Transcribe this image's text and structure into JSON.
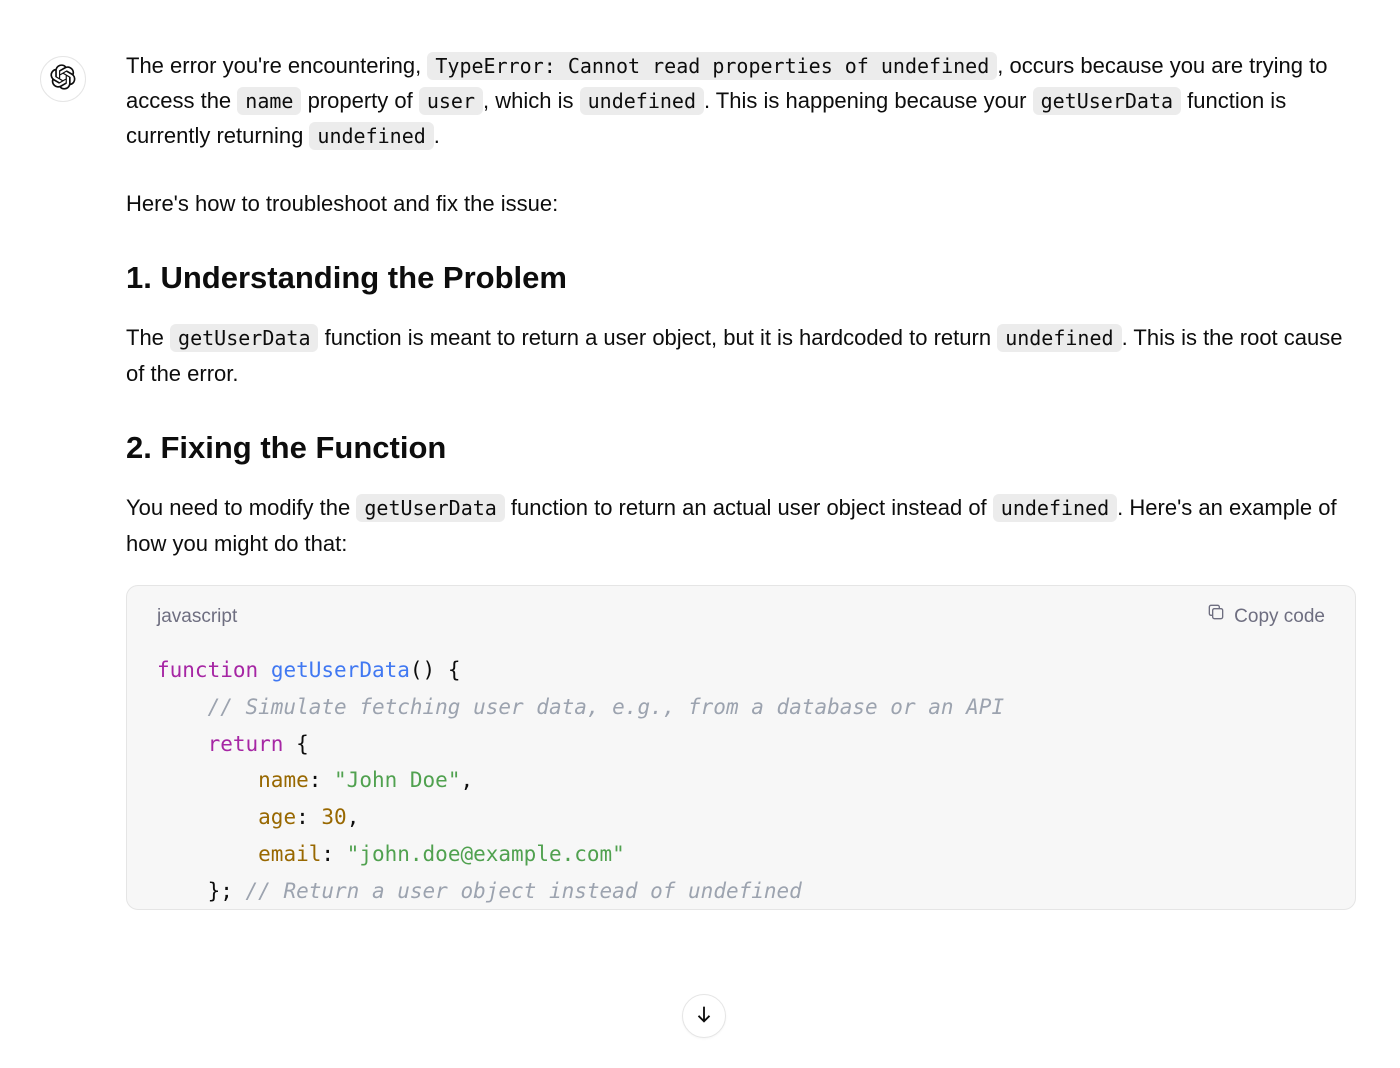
{
  "msg": {
    "intro": {
      "t0": "The error you're encountering, ",
      "c0": "TypeError: Cannot read properties of undefined",
      "t1": ", occurs because you are trying to access the ",
      "c1": "name",
      "t2": " property of ",
      "c2": "user",
      "t3": ", which is ",
      "c3": "undefined",
      "t4": ". This is happening because your ",
      "c4": "getUserData",
      "t5": " function is currently returning ",
      "c5": "undefined",
      "t6": "."
    },
    "lead": "Here's how to troubleshoot and fix the issue:",
    "h1": "1. Understanding the Problem",
    "p1": {
      "t0": "The ",
      "c0": "getUserData",
      "t1": " function is meant to return a user object, but it is hardcoded to return ",
      "c1": "undefined",
      "t2": ". This is the root cause of the error."
    },
    "h2": "2. Fixing the Function",
    "p2": {
      "t0": "You need to modify the ",
      "c0": "getUserData",
      "t1": " function to return an actual user object instead of ",
      "c1": "undefined",
      "t2": ". Here's an example of how you might do that:"
    }
  },
  "codeblock": {
    "lang": "javascript",
    "copy_label": "Copy code",
    "code": {
      "fn_kw": "function",
      "fn_name": "getUserData",
      "fn_sig": "() {",
      "comment1": "// Simulate fetching user data, e.g., from a database or an API",
      "ret_kw": "return",
      "brace_open": " {",
      "prop_name": "name",
      "val_name": "\"John Doe\"",
      "comma": ",",
      "prop_age": "age",
      "val_age": "30",
      "prop_email": "email",
      "val_email": "\"john.doe@example.com\"",
      "brace_close": "};",
      "comment2": "// Return a user object instead of undefined"
    }
  }
}
